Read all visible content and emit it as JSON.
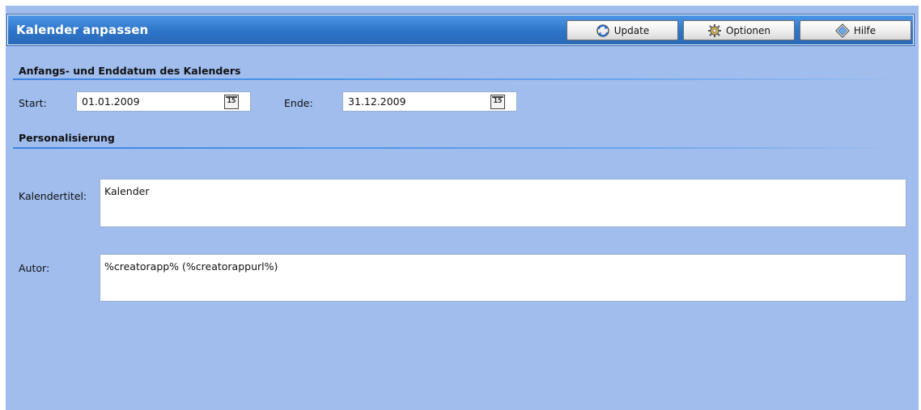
{
  "window": {
    "title": "Kalender anpassen"
  },
  "toolbar": {
    "update_label": "Update",
    "options_label": "Optionen",
    "help_label": "Hilfe"
  },
  "dates_section": {
    "title": "Anfangs- und Enddatum des Kalenders",
    "start_label": "Start:",
    "start_value": "01.01.2009",
    "end_label": "Ende:",
    "end_value": "31.12.2009",
    "calendar_icon_text": "15"
  },
  "personal_section": {
    "title": "Personalisierung",
    "calendar_title_label": "Kalendertitel:",
    "calendar_title_value": "Kalender",
    "author_label": "Autor:",
    "author_value": "%creatorapp% (%creatorappurl%)"
  },
  "icons": [
    "update-icon",
    "options-icon",
    "help-icon",
    "calendar-icon"
  ],
  "colors": {
    "background": "#a0bdee",
    "titlebar": "#2d74c8",
    "accent_line": "#3a82e0"
  }
}
